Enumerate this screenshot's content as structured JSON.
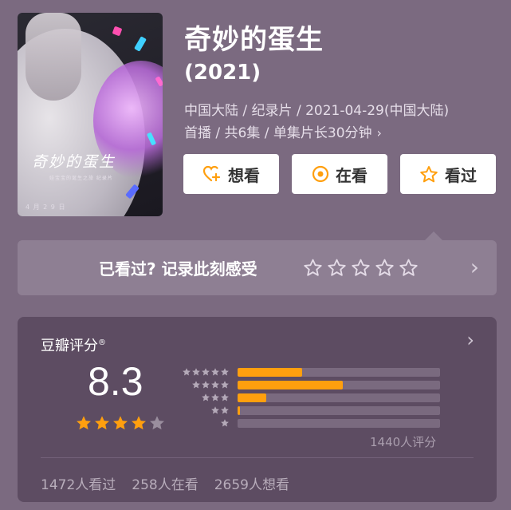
{
  "movie": {
    "title": "奇妙的蛋生",
    "year": "(2021)",
    "meta_line1": "中国大陆 / 纪录片 / 2021-04-29(中国大陆)",
    "meta_line2": "首播 / 共6集 / 单集片长30分钟",
    "poster": {
      "title": "奇妙的蛋生",
      "subtitle": "娃宝宝的诞生之旅 纪录片",
      "date": "4 月 2 9 日"
    }
  },
  "actions": [
    {
      "label": "想看",
      "icon": "heart-plus-icon"
    },
    {
      "label": "在看",
      "icon": "circle-dot-icon"
    },
    {
      "label": "看过",
      "icon": "star-outline-icon"
    }
  ],
  "record": {
    "prompt": "已看过? 记录此刻感受",
    "star_count": 5
  },
  "rating": {
    "title": "豆瓣评分",
    "title_mark": "®",
    "score": "8.3",
    "score_stars": 4,
    "distribution": [
      {
        "stars": 5,
        "fraction": 0.32
      },
      {
        "stars": 4,
        "fraction": 0.52
      },
      {
        "stars": 3,
        "fraction": 0.14
      },
      {
        "stars": 2,
        "fraction": 0.01
      },
      {
        "stars": 1,
        "fraction": 0.0
      }
    ],
    "rating_count": "1440人评分",
    "watched": "1472人看过",
    "watching": "258人在看",
    "want": "2659人想看"
  },
  "colors": {
    "background": "#7b6a80",
    "accent": "#ff9f0e",
    "card": "#5d4c62"
  }
}
